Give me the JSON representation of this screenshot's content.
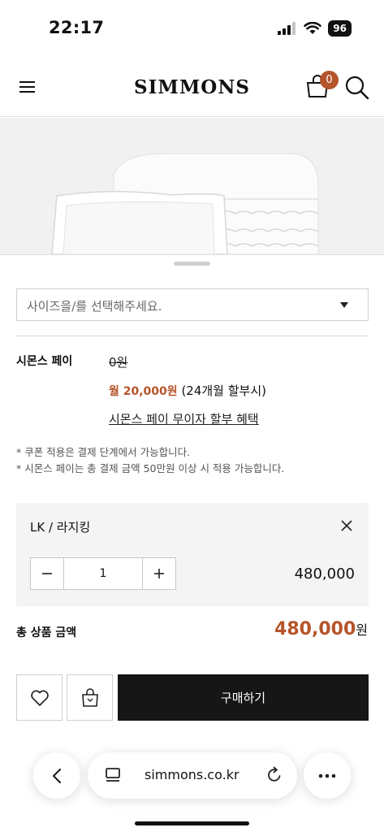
{
  "status_bar": {
    "time": "22:17",
    "battery": "96"
  },
  "header": {
    "logo": "SIMMONS",
    "cart_count": "0"
  },
  "option_select": {
    "placeholder": "사이즈을/를 선택해주세요."
  },
  "simmons_pay": {
    "label": "시몬스 페이",
    "original_price": "0원",
    "monthly_price": "월 20,000원",
    "monthly_term": " (24개월 할부시)",
    "benefit_link": "시몬스 페이 무이자 할부 혜택"
  },
  "notes": [
    "* 쿠폰 적용은 결제 단계에서 가능합니다.",
    "* 시몬스 페이는 총 결제 금액 50만원 이상 시 적용 가능합니다."
  ],
  "selected_option": {
    "name": "LK / 라지킹",
    "quantity": "1",
    "price": "480,000"
  },
  "total": {
    "label": "총 상품 금액",
    "amount": "480,000",
    "currency": "원"
  },
  "actions": {
    "buy_label": "구매하기"
  },
  "browser": {
    "url": "simmons.co.kr"
  },
  "colors": {
    "accent": "#b5542a",
    "buy_button": "#161616"
  }
}
